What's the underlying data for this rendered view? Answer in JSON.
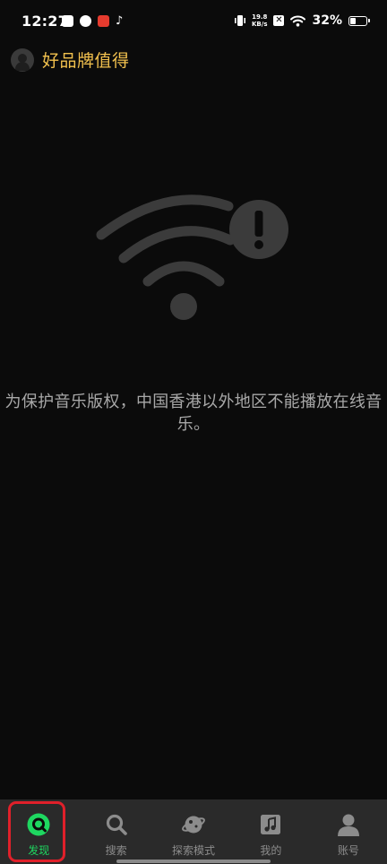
{
  "status_bar": {
    "time": "12:27",
    "net_speed_value": "19.8",
    "net_speed_unit": "KB/s",
    "x_badge": "✕",
    "tiktok_glyph": "♪",
    "battery_percent": "32%",
    "battery_level": 0.32
  },
  "header": {
    "title": "好品牌值得",
    "avatar_icon": "avatar-icon"
  },
  "empty_state": {
    "icon": "wifi-error-icon",
    "message": "为保护音乐版权，中国香港以外地区不能播放在线音乐。"
  },
  "bottom_nav": {
    "items": [
      {
        "label": "发现",
        "icon": "discover-icon",
        "active": true
      },
      {
        "label": "搜索",
        "icon": "search-icon",
        "active": false
      },
      {
        "label": "探索模式",
        "icon": "planet-icon",
        "active": false
      },
      {
        "label": "我的",
        "icon": "music-library-icon",
        "active": false
      },
      {
        "label": "账号",
        "icon": "account-icon",
        "active": false
      }
    ]
  },
  "colors": {
    "background": "#0b0b0b",
    "accent": "#1ed760",
    "header_title": "#f2c14e",
    "nav_background": "#2a2a2a",
    "highlight_frame": "#e0202a"
  }
}
